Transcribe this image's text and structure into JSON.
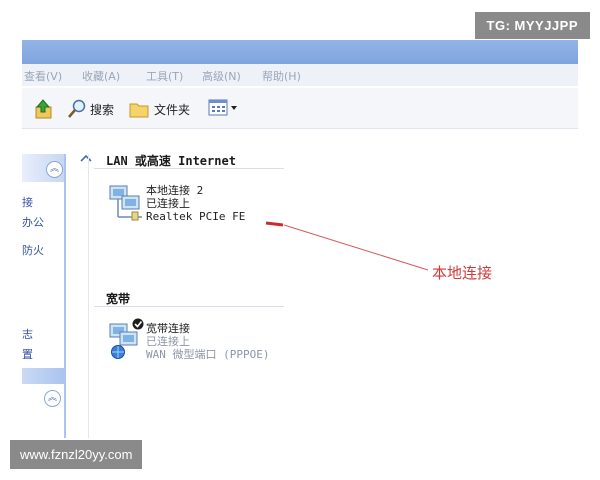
{
  "watermarks": {
    "top_right": "TG: MYYJJPP",
    "bottom_left": "www.fznzl20yy.com"
  },
  "menubar": {
    "items": [
      "查看(V)",
      "收藏(A)",
      "工具(T)",
      "高级(N)",
      "帮助(H)"
    ]
  },
  "toolbar": {
    "search_label": "搜索",
    "folders_label": "文件夹"
  },
  "left_pane": {
    "lines": [
      "接",
      "办公",
      "防火",
      "志",
      "置"
    ]
  },
  "sections": [
    {
      "title": "LAN 或高速 Internet",
      "connection": {
        "name": "本地连接 2",
        "status": "已连接上",
        "device": "Realtek PCIe FE"
      }
    },
    {
      "title": "宽带",
      "connection": {
        "name": "宽带连接",
        "status": "已连接上",
        "device": "WAN 微型端口 (PPPOE)"
      }
    }
  ],
  "annotation": {
    "text": "本地连接",
    "color": "#d23a3a"
  },
  "colors": {
    "titlebar": "#7fa4dd",
    "left_pane": "#a9c3ee",
    "link_text": "#3552a0"
  },
  "icons": {
    "up": "up-folder-icon",
    "search": "magnifier-icon",
    "folders": "folder-icon",
    "views": "views-icon",
    "network": "network-connection-icon",
    "broadband": "broadband-connection-icon"
  }
}
